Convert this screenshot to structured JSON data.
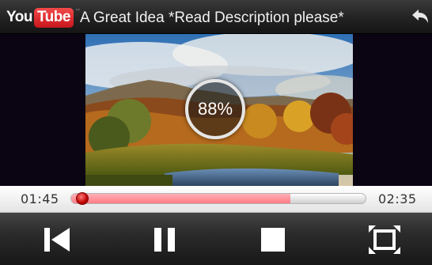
{
  "app": {
    "logo_you": "You",
    "logo_tube": "Tube",
    "logo_tm": "™"
  },
  "video": {
    "title": "A Great Idea *Read Description please*"
  },
  "player": {
    "buffer_percent": "88%",
    "current_time": "01:45",
    "total_time": "02:35",
    "progress_fraction": 0.745,
    "thumb_fraction": 0.02
  },
  "controls": {
    "icons": [
      "skip-previous-icon",
      "pause-icon",
      "stop-icon",
      "fullscreen-icon"
    ]
  },
  "colors": {
    "progress_fill": "#ff8a93",
    "thumb": "#c00000",
    "youtube_red": "#e0262b"
  }
}
